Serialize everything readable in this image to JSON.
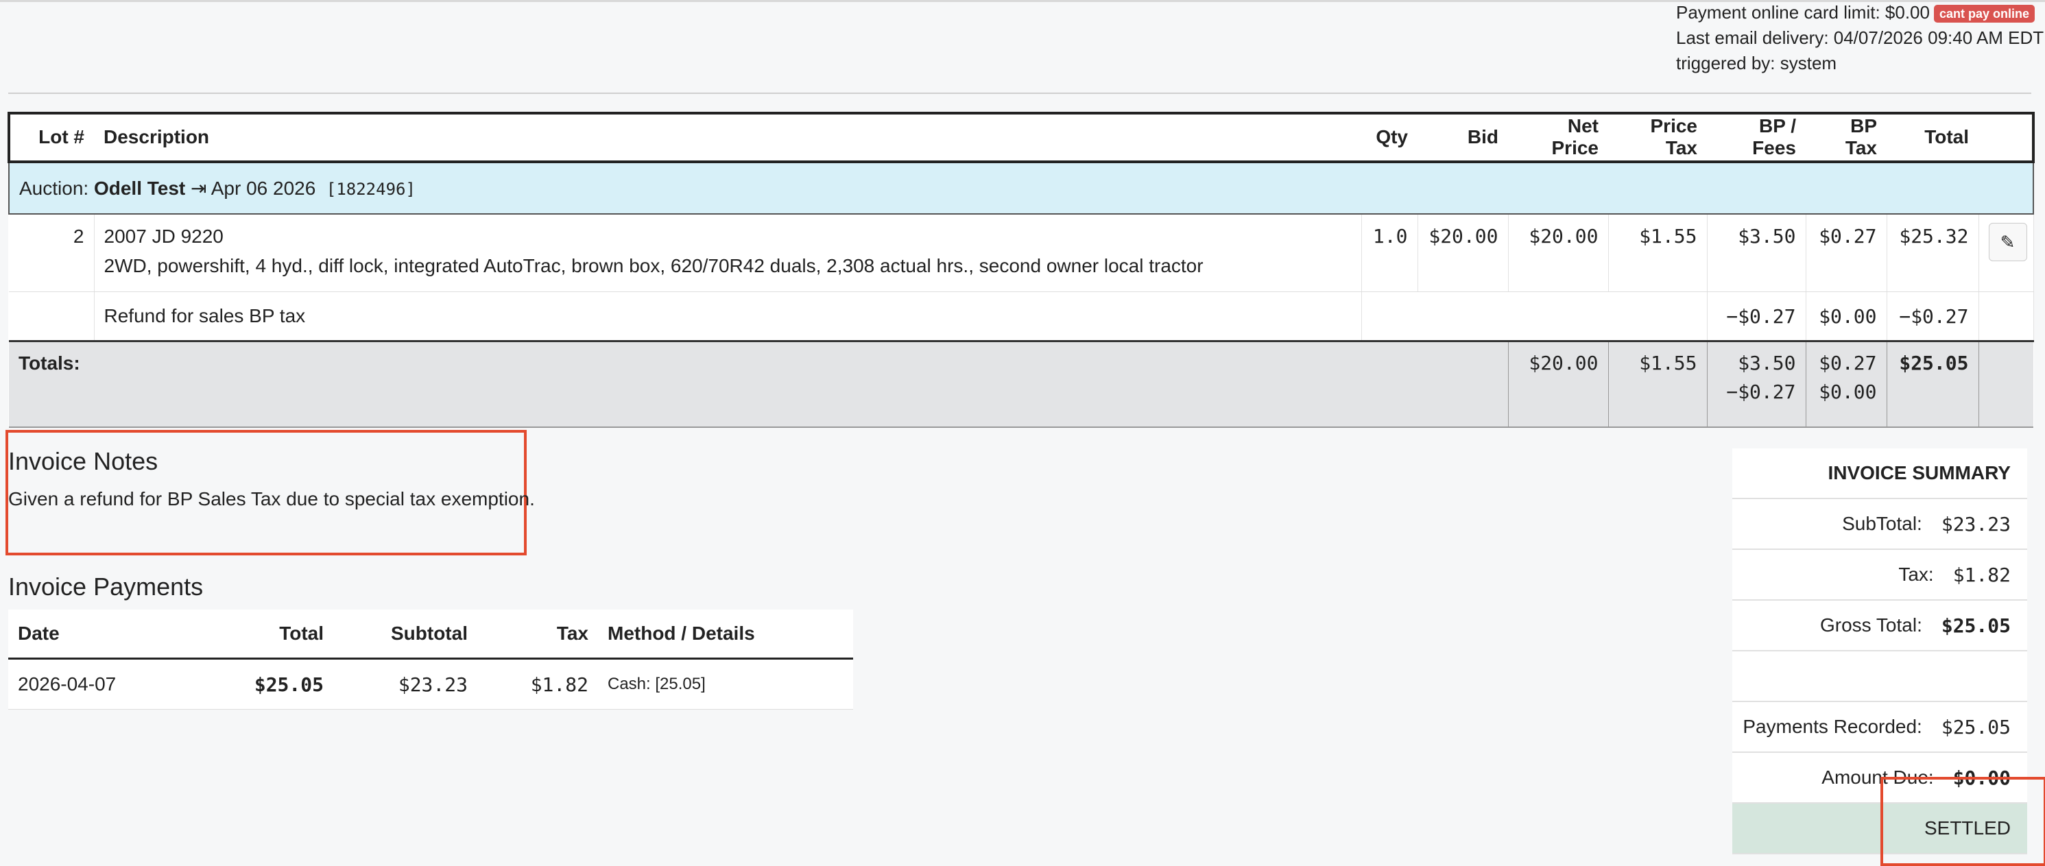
{
  "top_info": {
    "card_limit": "Payment online card limit: $0.00",
    "card_badge": "cant pay online",
    "last_email": "Last email delivery: 04/07/2026 09:40 AM EDT",
    "triggered_by": "triggered by: system"
  },
  "columns": {
    "lot": "Lot #",
    "description": "Description",
    "qty": "Qty",
    "bid": "Bid",
    "net_price": "Net Price",
    "price_tax": "Price Tax",
    "bp_fees": "BP / Fees",
    "bp_tax": "BP Tax",
    "total": "Total"
  },
  "auction": {
    "prefix": "Auction:",
    "name": "Odell Test",
    "arrow": "⇥",
    "date": "Apr 06 2026",
    "id": "[1822496]"
  },
  "lot": {
    "number": "2",
    "title": "2007 JD 9220",
    "details": "2WD, powershift, 4 hyd., diff lock, integrated AutoTrac, brown box, 620/70R42 duals, 2,308 actual hrs., second owner local tractor",
    "qty": "1.0",
    "bid": "$20.00",
    "net_price": "$20.00",
    "price_tax": "$1.55",
    "bp_fees": "$3.50",
    "bp_tax": "$0.27",
    "total": "$25.32"
  },
  "refund": {
    "description": "Refund for sales BP tax",
    "bp_fees": "−$0.27",
    "bp_tax": "$0.00",
    "total": "−$0.27"
  },
  "totals": {
    "label": "Totals:",
    "net_price": "$20.00",
    "price_tax": "$1.55",
    "bp_fees_1": "$3.50",
    "bp_fees_2": "−$0.27",
    "bp_tax_1": "$0.27",
    "bp_tax_2": "$0.00",
    "total": "$25.05"
  },
  "notes": {
    "title": "Invoice Notes",
    "text": "Given a refund for BP Sales Tax due to special tax exemption."
  },
  "payments": {
    "title": "Invoice Payments",
    "headers": {
      "date": "Date",
      "total": "Total",
      "subtotal": "Subtotal",
      "tax": "Tax",
      "method": "Method / Details"
    },
    "rows": [
      {
        "date": "2026-04-07",
        "total": "$25.05",
        "subtotal": "$23.23",
        "tax": "$1.82",
        "method": "Cash: [25.05]"
      }
    ]
  },
  "summary": {
    "title": "INVOICE SUMMARY",
    "subtotal_label": "SubTotal:",
    "subtotal": "$23.23",
    "tax_label": "Tax:",
    "tax": "$1.82",
    "gross_label": "Gross Total:",
    "gross": "$25.05",
    "payments_label": "Payments Recorded:",
    "payments": "$25.05",
    "due_label": "Amount Due:",
    "due": "$0.00",
    "status": "SETTLED"
  },
  "colors": {
    "highlight_box": "#e34a2e",
    "auction_row_bg": "#d7f0f8",
    "settled_bg": "#d5e6dd",
    "badge_bg": "#d9534f"
  },
  "icons": {
    "edit": "edit-icon"
  }
}
